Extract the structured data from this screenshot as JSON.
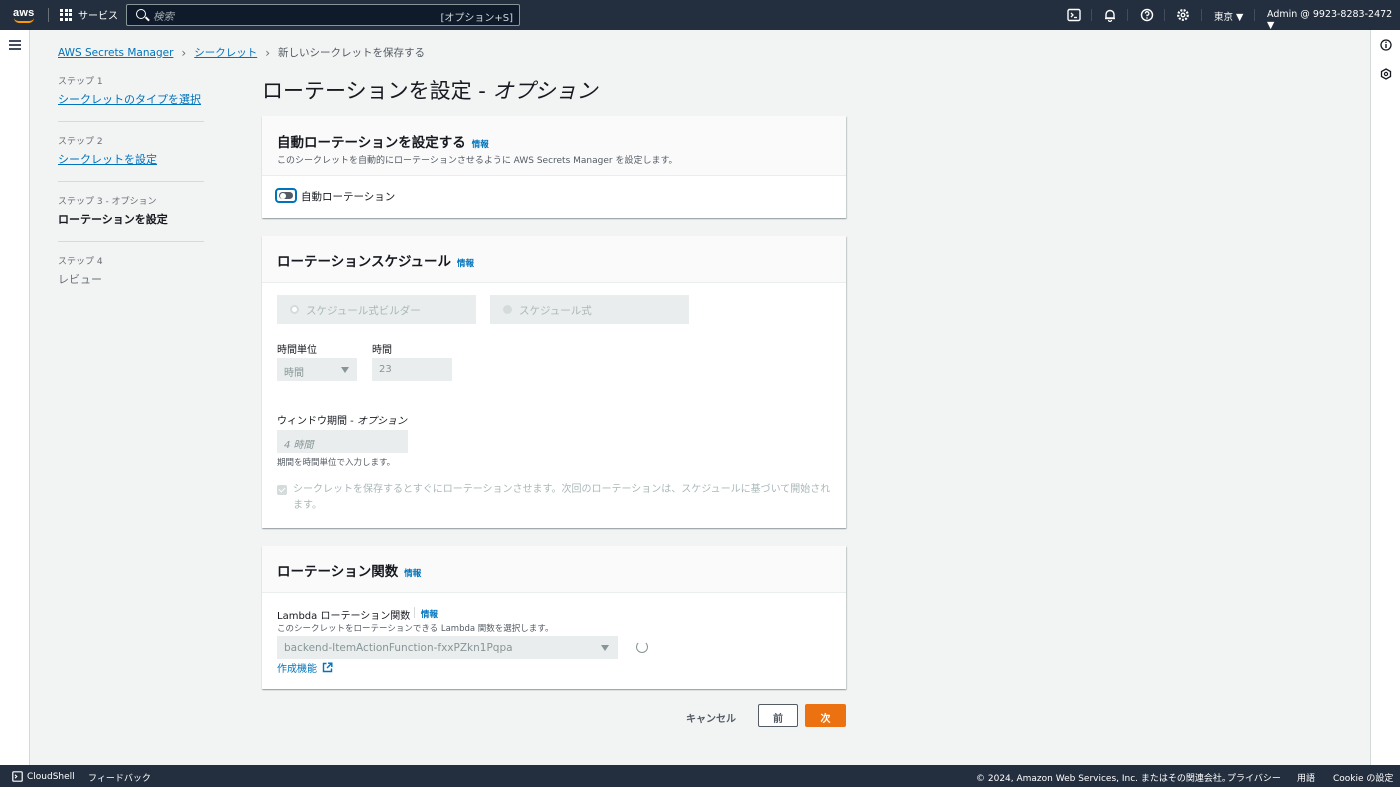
{
  "nav": {
    "logo_text": "aws",
    "services_label": "サービス",
    "search_placeholder": "検索",
    "search_shortcut": "[オプション+S]",
    "region": "東京 ▼",
    "account": "Admin @ 9923-8283-2472 ▼"
  },
  "breadcrumb": {
    "items": [
      "AWS Secrets Manager",
      "シークレット",
      "新しいシークレットを保存する"
    ]
  },
  "steps": [
    {
      "label": "ステップ 1",
      "name": "シークレットのタイプを選択"
    },
    {
      "label": "ステップ 2",
      "name": "シークレットを設定"
    },
    {
      "label": "ステップ 3 - オプション",
      "name": "ローテーションを設定"
    },
    {
      "label": "ステップ 4",
      "name": "レビュー"
    }
  ],
  "page": {
    "title_main": "ローテーションを設定 - ",
    "title_opt": "オプション"
  },
  "auto_rotation": {
    "heading": "自動ローテーションを設定する",
    "info": "情報",
    "description": "このシークレットを自動的にローテーションさせるように AWS Secrets Manager を設定します。",
    "toggle_label": "自動ローテーション",
    "toggle_on": false
  },
  "schedule": {
    "heading": "ローテーションスケジュール",
    "info": "情報",
    "option_builder": "スケジュール式ビルダー",
    "option_expression": "スケジュール式",
    "time_unit_label": "時間単位",
    "time_unit_value": "時間",
    "time_label": "時間",
    "time_value": "23",
    "window_label_main": "ウィンドウ期間 - ",
    "window_label_opt": "オプション",
    "window_placeholder": "4 時間",
    "window_hint": "期間を時間単位で入力します。",
    "checkbox_label": "シークレットを保存するとすぐにローテーションさせます。次回のローテーションは、スケジュールに基づいて開始されます。",
    "checkbox_checked": true
  },
  "function": {
    "heading": "ローテーション関数",
    "info": "情報",
    "field_label": "Lambda ローテーション関数",
    "field_info": "情報",
    "field_desc": "このシークレットをローテーションできる Lambda 関数を選択します。",
    "selected": "backend-ItemActionFunction-fxxPZkn1Pqpa",
    "create_link": "作成機能"
  },
  "actions": {
    "cancel": "キャンセル",
    "prev": "前",
    "next": "次"
  },
  "footer": {
    "cloudshell": "CloudShell",
    "feedback": "フィードバック",
    "copyright": "© 2024, Amazon Web Services, Inc. またはその関連会社。",
    "privacy": "プライバシー",
    "terms": "用語",
    "cookie": "Cookie の設定"
  },
  "colors": {
    "nav_bg": "#232f3e",
    "link": "#0073bb",
    "primary_button": "#ec7211"
  }
}
